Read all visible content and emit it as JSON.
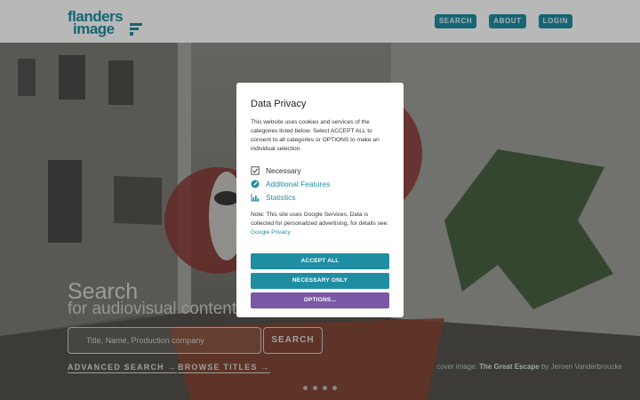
{
  "header": {
    "logo_line1": "flanders",
    "logo_line2": "image",
    "nav": [
      "SEARCH",
      "ABOUT",
      "LOGIN"
    ]
  },
  "hero": {
    "title": "Search",
    "subtitle": "for audiovisual content",
    "search_placeholder": "Title, Name, Production company",
    "search_button": "SEARCH",
    "advanced_link": "ADVANCED SEARCH →",
    "browse_link": "BROWSE TITLES →",
    "credit_prefix": "cover image: ",
    "credit_title": "The Great Escape",
    "credit_suffix": " by Jeroen Vanderbroucke",
    "slide_count": 4
  },
  "privacy": {
    "title": "Data Privacy",
    "description": "This website uses cookies and services of the categories listed below. Select ACCEPT ALL to consent to all categories or OPTIONS to make an individual selection.",
    "categories": [
      {
        "label": "Necessary",
        "icon": "checkbox-icon",
        "color": "#333333"
      },
      {
        "label": "Additional Features",
        "icon": "rocket-icon",
        "color": "#1f8ea3"
      },
      {
        "label": "Statistics",
        "icon": "bar-chart-icon",
        "color": "#1f8ea3"
      }
    ],
    "note": "Note: This site uses Google Services. Data is collected for personalized advertising, for details see: ",
    "note_link": "Google Privacy",
    "accept_all": "ACCEPT ALL",
    "necessary_only": "NECESSARY ONLY",
    "options": "OPTIONS...",
    "colors": {
      "accent": "#1f8ea3",
      "options": "#7b58a6"
    }
  }
}
